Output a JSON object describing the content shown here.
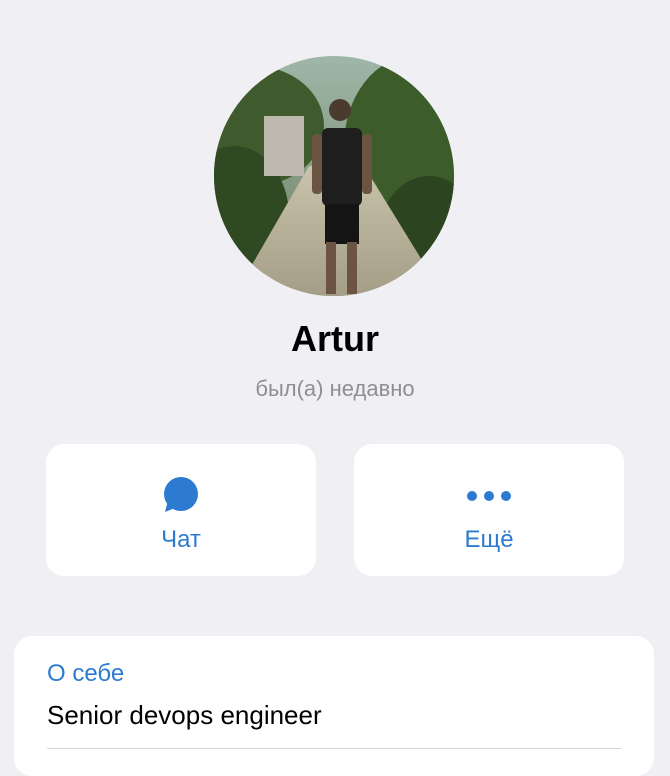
{
  "profile": {
    "name": "Artur",
    "status": "был(а) недавно",
    "avatar": "profile-photo"
  },
  "actions": {
    "chat": {
      "label": "Чат",
      "icon": "chat-bubble-icon"
    },
    "more": {
      "label": "Ещё",
      "icon": "more-dots-icon"
    }
  },
  "about": {
    "title": "О себе",
    "value": "Senior devops engineer"
  },
  "colors": {
    "accent": "#2D7BD1",
    "background": "#EFEFF4",
    "card": "#FFFFFF",
    "secondary_text": "#8E8E93"
  }
}
